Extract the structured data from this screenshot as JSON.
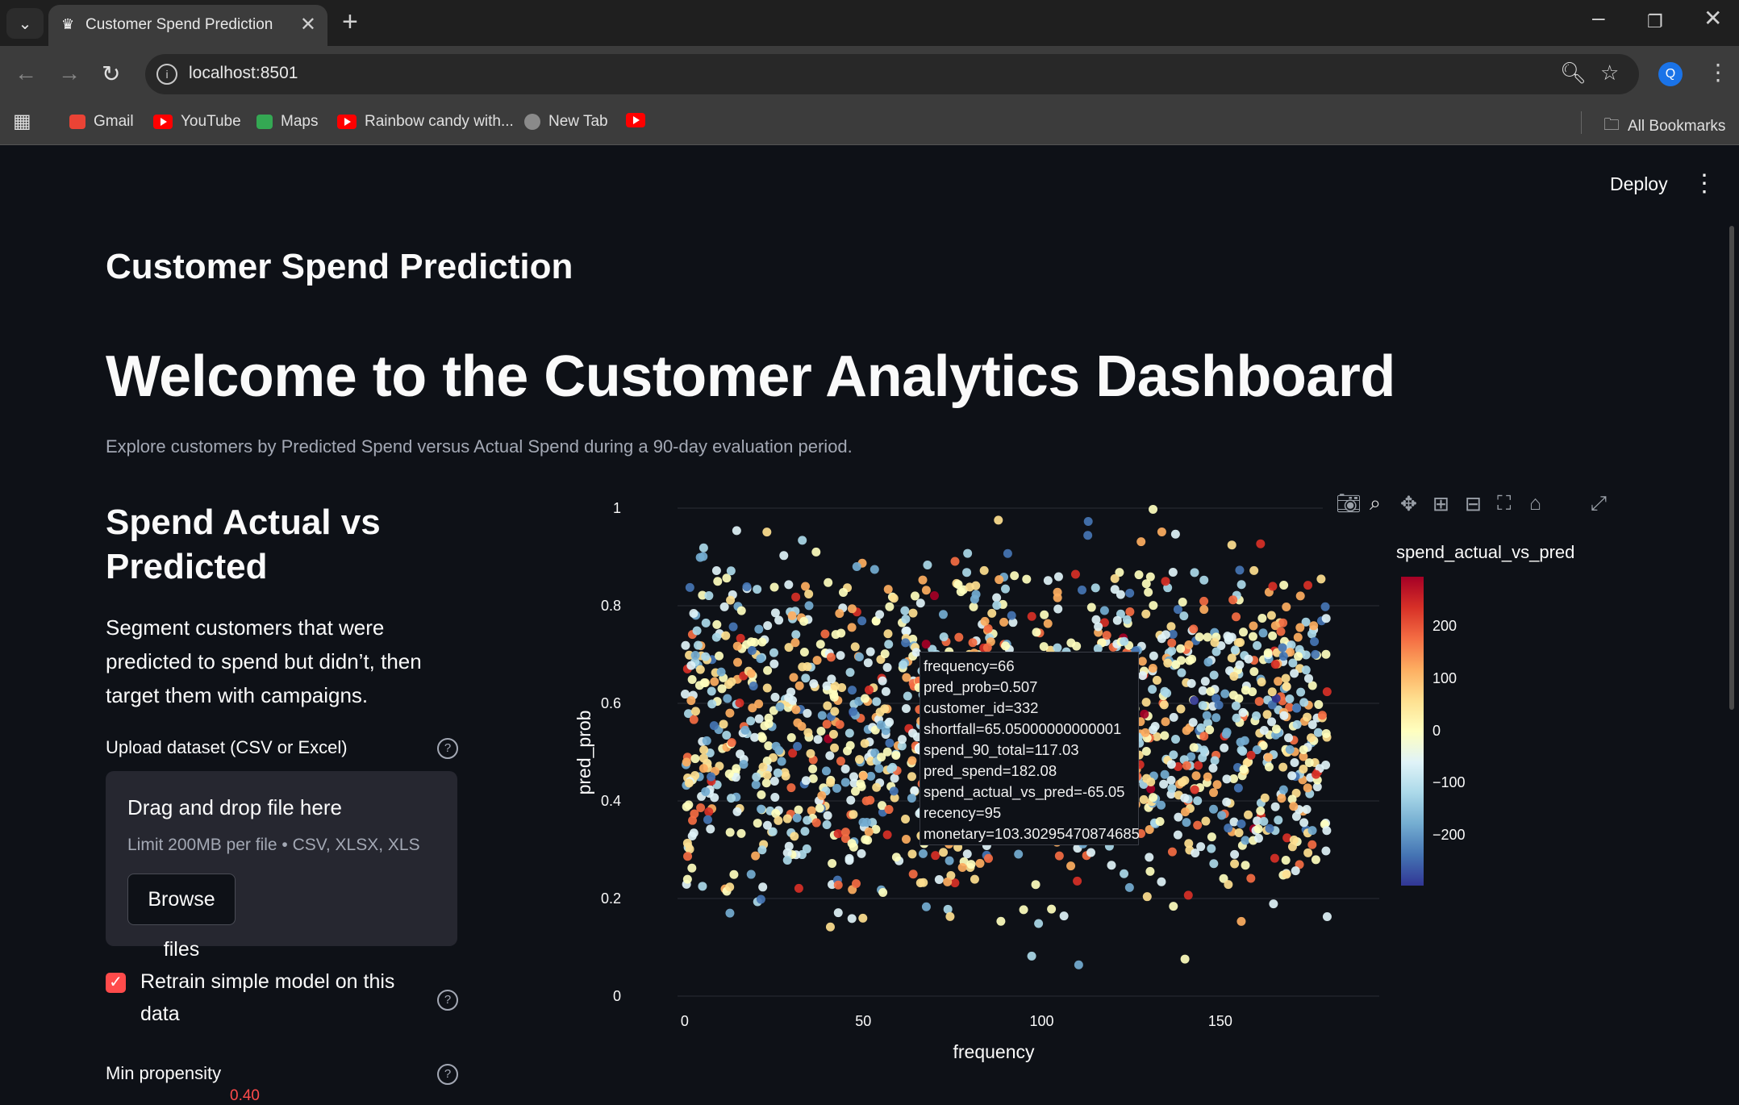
{
  "browser": {
    "tab_title": "Customer Spend Prediction",
    "url": "localhost:8501",
    "profile_initial": "Q",
    "bookmarks": [
      "Gmail",
      "YouTube",
      "Maps",
      "Rainbow candy with...",
      "New Tab"
    ],
    "all_bookmarks_label": "All Bookmarks"
  },
  "app": {
    "deploy_label": "Deploy",
    "title": "Customer Spend Prediction",
    "welcome_heading": "Welcome to the Customer Analytics Dashboard",
    "caption": "Explore customers by Predicted Spend versus Actual Spend during a 90-day evaluation period.",
    "section_heading": "Spend Actual vs Predicted",
    "section_text": "Segment customers that were predicted to spend but didn’t, then target them with campaigns.",
    "upload": {
      "label": "Upload dataset (CSV or Excel)",
      "drop_title": "Drag and drop file here",
      "limit": "Limit 200MB per file • CSV, XLSX, XLS",
      "browse_label": "Browse files"
    },
    "retrain": {
      "label": "Retrain simple model on this data",
      "checked": true
    },
    "min_propensity": {
      "label": "Min propensity",
      "value": "0.40"
    }
  },
  "tooltip": {
    "frequency": "frequency=66",
    "pred_prob": "pred_prob=0.507",
    "customer_id": "customer_id=332",
    "shortfall": "shortfall=65.05000000000001",
    "spend_90_total": "spend_90_total=117.03",
    "pred_spend": "pred_spend=182.08",
    "spend_actual_vs_pred": "spend_actual_vs_pred=-65.05",
    "recency": "recency=95",
    "monetary": "monetary=103.30295470874685"
  },
  "chart_data": {
    "type": "scatter",
    "xlabel": "frequency",
    "ylabel": "pred_prob",
    "xlim": [
      -2,
      190
    ],
    "ylim": [
      0,
      1
    ],
    "x_ticks": [
      "0",
      "50",
      "100",
      "150"
    ],
    "y_ticks": [
      "0",
      "0.2",
      "0.4",
      "0.6",
      "0.8",
      "1"
    ],
    "color_variable": "spend_actual_vs_pred",
    "color_range": [
      -290,
      290
    ],
    "colorbar_ticks": [
      "200",
      "100",
      "0",
      "−100",
      "−200"
    ],
    "colorscale": [
      "#313695",
      "#4575b4",
      "#74add1",
      "#abd9e9",
      "#e0f3f8",
      "#ffffbf",
      "#fee090",
      "#fdae61",
      "#f46d43",
      "#d73027",
      "#a50026"
    ],
    "point_count": 1500,
    "x_range_points": [
      0,
      180
    ],
    "density_note": "dense between pred_prob 0.3 and 0.85, sparse near 0 and 1",
    "highlighted_point": {
      "frequency": 66,
      "pred_prob": 0.507,
      "spend_actual_vs_pred": -65.05
    }
  }
}
